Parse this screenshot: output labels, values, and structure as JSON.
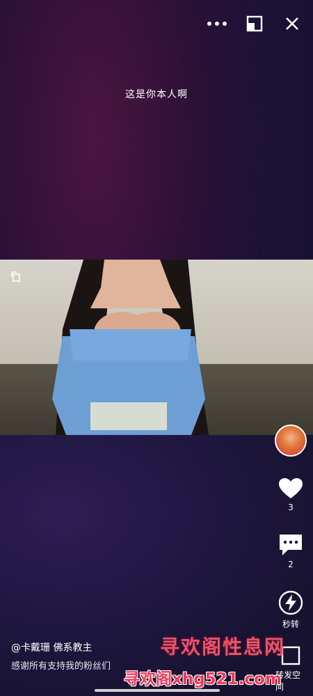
{
  "topbar": {
    "more_icon": "more-dots-icon",
    "pip_icon": "picture-in-picture-icon",
    "close_icon": "close-icon"
  },
  "caption": "这是你本人啊",
  "video": {
    "rotate_icon": "rotate-screen-icon"
  },
  "sidebar": {
    "like_count": "3",
    "comment_count": "2",
    "repost_label": "秒转",
    "share_label": "转发空间"
  },
  "post": {
    "author": "@卡戴珊  佛系教主",
    "description": "感谢所有支持我的粉丝们"
  },
  "watermark": {
    "line1": "寻欢阁性息网",
    "line2": "寻欢阁xhg521.com"
  },
  "colors": {
    "accent_red": "#f0385a",
    "background": "#1a1236"
  }
}
